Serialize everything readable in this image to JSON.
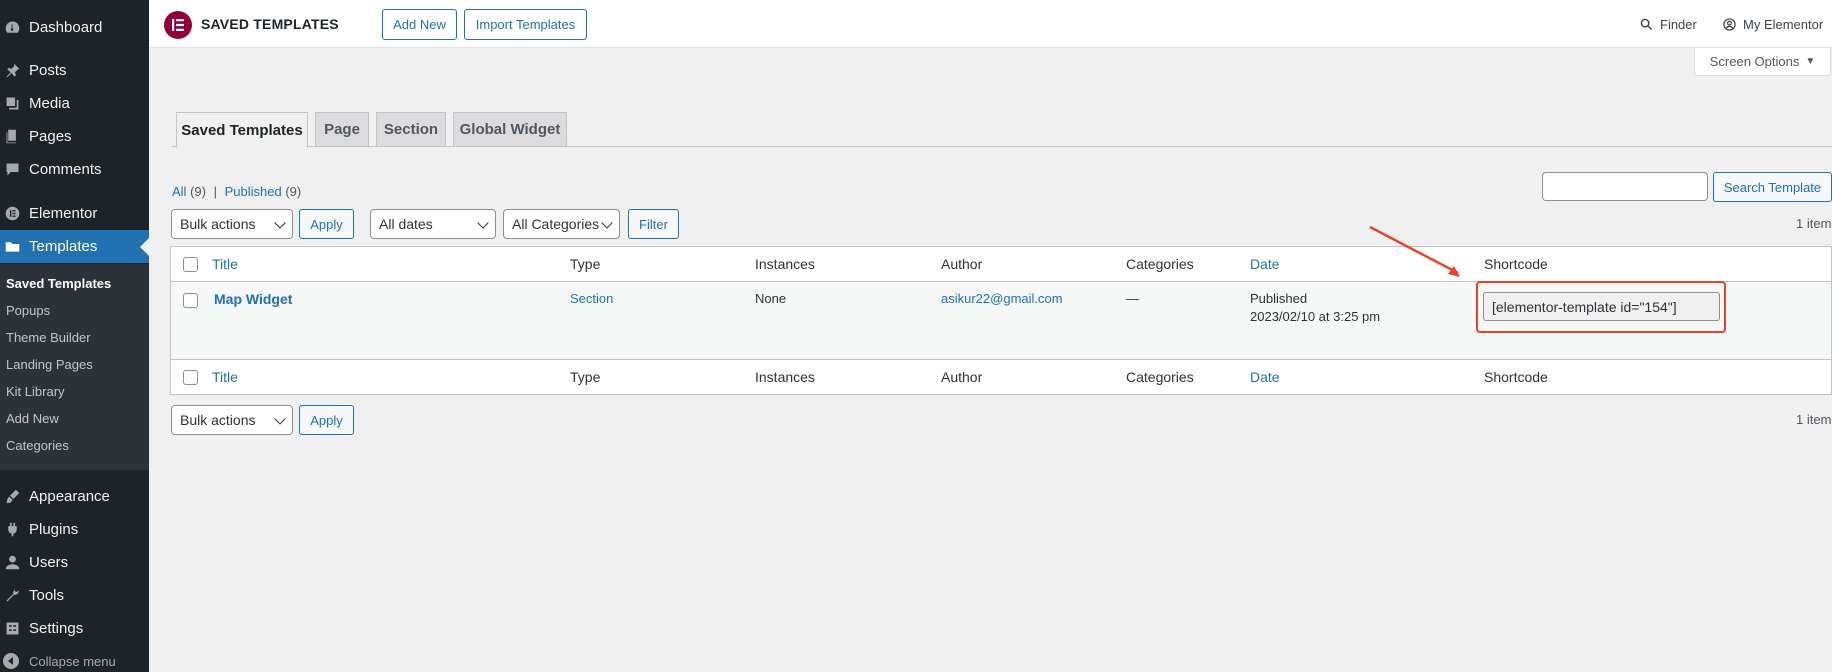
{
  "sidebar": {
    "items": [
      {
        "label": "Dashboard",
        "icon": "dashboard-icon"
      },
      {
        "label": "Posts",
        "icon": "pin-icon"
      },
      {
        "label": "Media",
        "icon": "media-icon"
      },
      {
        "label": "Pages",
        "icon": "pages-icon"
      },
      {
        "label": "Comments",
        "icon": "comment-icon"
      },
      {
        "label": "Elementor",
        "icon": "elementor-icon"
      },
      {
        "label": "Templates",
        "icon": "folder-icon"
      },
      {
        "label": "Appearance",
        "icon": "brush-icon"
      },
      {
        "label": "Plugins",
        "icon": "plugin-icon"
      },
      {
        "label": "Users",
        "icon": "user-icon"
      },
      {
        "label": "Tools",
        "icon": "wrench-icon"
      },
      {
        "label": "Settings",
        "icon": "settings-icon"
      }
    ],
    "submenu": [
      "Saved Templates",
      "Popups",
      "Theme Builder",
      "Landing Pages",
      "Kit Library",
      "Add New",
      "Categories"
    ],
    "collapse_label": "Collapse menu"
  },
  "topbar": {
    "title": "SAVED TEMPLATES",
    "add_new": "Add New",
    "import": "Import Templates",
    "finder": "Finder",
    "my_elementor": "My Elementor"
  },
  "screen_options": "Screen Options",
  "tabs": [
    "Saved Templates",
    "Page",
    "Section",
    "Global Widget"
  ],
  "views": {
    "all_label": "All",
    "all_count": "(9)",
    "separator": "|",
    "published_label": "Published",
    "published_count": "(9)"
  },
  "filters": {
    "bulk_actions": "Bulk actions",
    "apply": "Apply",
    "all_dates": "All dates",
    "all_categories": "All Categories",
    "filter": "Filter",
    "search_button": "Search Template",
    "items_count": "1 item"
  },
  "table": {
    "columns": [
      "Title",
      "Type",
      "Instances",
      "Author",
      "Categories",
      "Date",
      "Shortcode"
    ],
    "rows": [
      {
        "title": "Map Widget",
        "type": "Section",
        "instances": "None",
        "author": "asikur22@gmail.com",
        "categories": "—",
        "date_status": "Published",
        "date": "2023/02/10 at 3:25 pm",
        "shortcode": "[elementor-template id=\"154\"]"
      }
    ]
  },
  "colors": {
    "sidebar_bg": "#1d2327",
    "accent": "#2271b1",
    "annotation_red": "#e8432c",
    "elementor_brand": "#92003b"
  }
}
